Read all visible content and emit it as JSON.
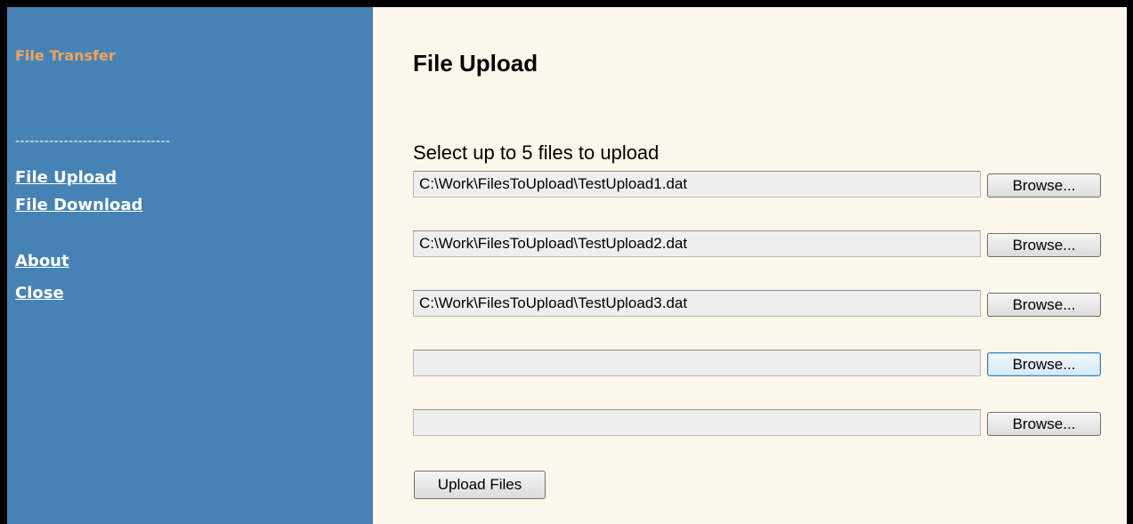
{
  "sidebar": {
    "app_title": "File Transfer",
    "divider": "--------------------------------",
    "links": {
      "file_upload": "File Upload",
      "file_download": "File Download",
      "about": "About",
      "close": "Close"
    }
  },
  "main": {
    "title": "File Upload",
    "instructions": "Select up to 5 files to upload",
    "files": [
      {
        "value": "C:\\Work\\FilesToUpload\\TestUpload1.dat",
        "browse_label": "Browse..."
      },
      {
        "value": "C:\\Work\\FilesToUpload\\TestUpload2.dat",
        "browse_label": "Browse..."
      },
      {
        "value": "C:\\Work\\FilesToUpload\\TestUpload3.dat",
        "browse_label": "Browse..."
      },
      {
        "value": "",
        "browse_label": "Browse..."
      },
      {
        "value": "",
        "browse_label": "Browse..."
      }
    ],
    "upload_button": "Upload Files"
  },
  "colors": {
    "sidebar_bg": "#4682b4",
    "app_title": "#f4a460",
    "nav_link": "#ffffff",
    "main_bg": "#fdf7ec",
    "field_bg": "#efefef",
    "window_border": "#000000"
  }
}
